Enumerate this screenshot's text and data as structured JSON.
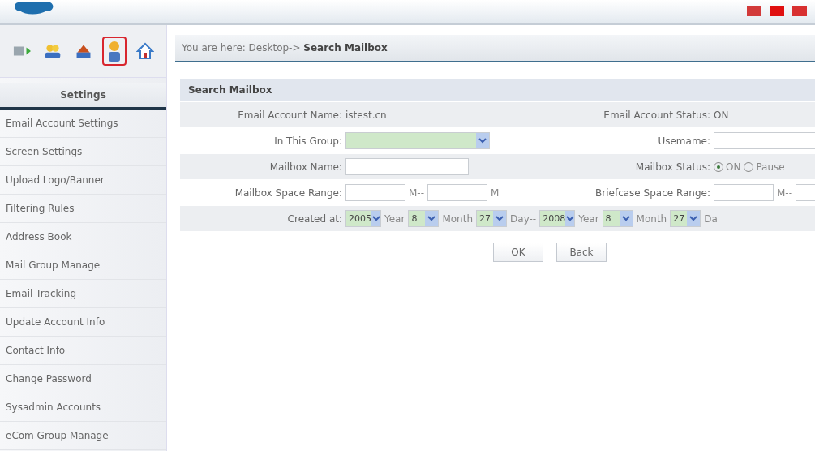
{
  "header": {
    "flags": [
      {
        "color": "#d23a3a"
      },
      {
        "color": "#e01010"
      },
      {
        "color": "#d83030"
      }
    ]
  },
  "toolbar": {
    "icons": [
      {
        "kind": "arrow",
        "selected": false
      },
      {
        "kind": "users",
        "selected": false
      },
      {
        "kind": "group",
        "selected": false
      },
      {
        "kind": "person",
        "selected": true
      },
      {
        "kind": "home",
        "selected": false
      }
    ]
  },
  "sidebar": {
    "title": "Settings",
    "items": [
      "Email Account Settings",
      "Screen Settings",
      "Upload Logo/Banner",
      "Filtering Rules",
      "Address Book",
      "Mail Group Manage",
      "Email Tracking",
      "Update Account Info",
      "Contact Info",
      "Change Password",
      "Sysadmin Accounts",
      "eCom Group Manage"
    ]
  },
  "breadcrumb": "You are here: Desktop-> **Search Mailbox**",
  "form": {
    "title": "Search Mailbox",
    "rows": [
      {
        "shaded": true,
        "cells": [
          {
            "kind": "text",
            "label": "Email Account Name:",
            "value": "istest.cn"
          },
          {
            "kind": "text",
            "label": "Email Account Status:",
            "value": "ON"
          }
        ]
      },
      {
        "shaded": false,
        "cells": [
          {
            "kind": "select",
            "label": "In This Group:"
          },
          {
            "kind": "input",
            "label": "Usemame:"
          }
        ]
      },
      {
        "shaded": true,
        "cells": [
          {
            "kind": "input",
            "label": "Mailbox Name:"
          },
          {
            "kind": "radio",
            "label": "Mailbox Status:",
            "options": [
              {
                "label": "ON",
                "selected": true
              },
              {
                "label": "Pause",
                "selected": false
              }
            ]
          }
        ]
      },
      {
        "shaded": false,
        "cells": [
          {
            "kind": "range",
            "label": "Mailbox Space Range:",
            "units": [
              "M--",
              "M"
            ]
          },
          {
            "kind": "range",
            "label": "Briefcase Space Range:",
            "units": [
              "M--"
            ]
          }
        ]
      },
      {
        "shaded": true,
        "cells": [
          {
            "kind": "dates",
            "label": "Created at:",
            "parts": [
              {
                "value": "2005",
                "unit": "Year"
              },
              {
                "value": "8",
                "unit": "Month"
              },
              {
                "value": "27",
                "unit": "Day--"
              },
              {
                "value": "2008",
                "unit": "Year"
              },
              {
                "value": "8",
                "unit": "Month"
              },
              {
                "value": "27",
                "unit": "Da"
              }
            ]
          }
        ]
      }
    ],
    "buttons": [
      "OK",
      "Back"
    ]
  }
}
